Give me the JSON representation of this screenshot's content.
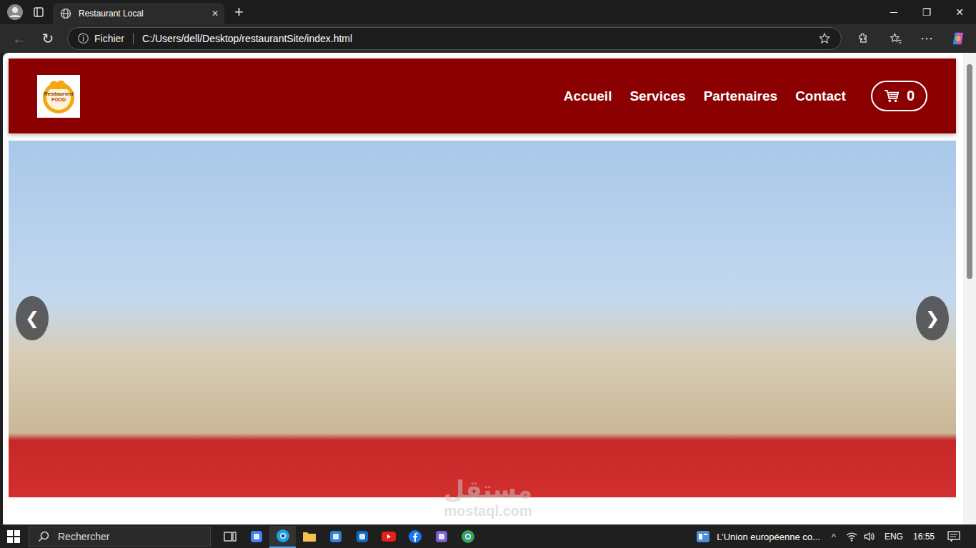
{
  "browser": {
    "profile_initial": "",
    "tabs": [
      {
        "label": "Restaurant Local",
        "selected": true,
        "close": "✕"
      }
    ],
    "new_tab": "+",
    "window_controls": [
      "─",
      "❐",
      "✕"
    ],
    "address": {
      "info": "ⓘ",
      "scheme": "Fichier",
      "url": "C:/Users/dell/Desktop/restaurantSite/index.html"
    },
    "back": "←",
    "reload": "↻",
    "more": "⋯",
    "scrollbar": {
      "level": 0.47
    }
  },
  "page": {
    "logo": {
      "line1": "Restaurent",
      "line2": "FOOD"
    },
    "nav": [
      {
        "label": "Accueil"
      },
      {
        "label": "Services"
      },
      {
        "label": "Partenaires"
      },
      {
        "label": "Contact"
      }
    ],
    "cart": {
      "count": "0"
    },
    "carousel": {
      "prev": "❮",
      "next": "❯"
    }
  },
  "watermark": {
    "arabic": "مستقل",
    "latin": "mostaql.com"
  },
  "taskbar": {
    "search": {
      "placeholder": "Rechercher"
    },
    "apps": [
      {
        "kind": "taskview",
        "color": "#d0d0d0",
        "active": false
      },
      {
        "kind": "copilot",
        "color": "#3b82f6",
        "active": false
      },
      {
        "kind": "edge",
        "color": "#1fa3e0",
        "active": true
      },
      {
        "kind": "explorer",
        "color": "#f2c14e",
        "active": false
      },
      {
        "kind": "store",
        "color": "#2f7fd8",
        "active": false
      },
      {
        "kind": "outlook",
        "color": "#0f6cbd",
        "active": false
      },
      {
        "kind": "youtube",
        "color": "#e62117",
        "active": false
      },
      {
        "kind": "facebook",
        "color": "#1877f2",
        "active": false
      },
      {
        "kind": "mixed",
        "color": "#7b5cd6",
        "active": false
      },
      {
        "kind": "chrome",
        "color": "#34a853",
        "active": false
      }
    ],
    "news": "L’Union européenne co...",
    "chevron": "^",
    "language": "ENG",
    "time": "16:55"
  }
}
